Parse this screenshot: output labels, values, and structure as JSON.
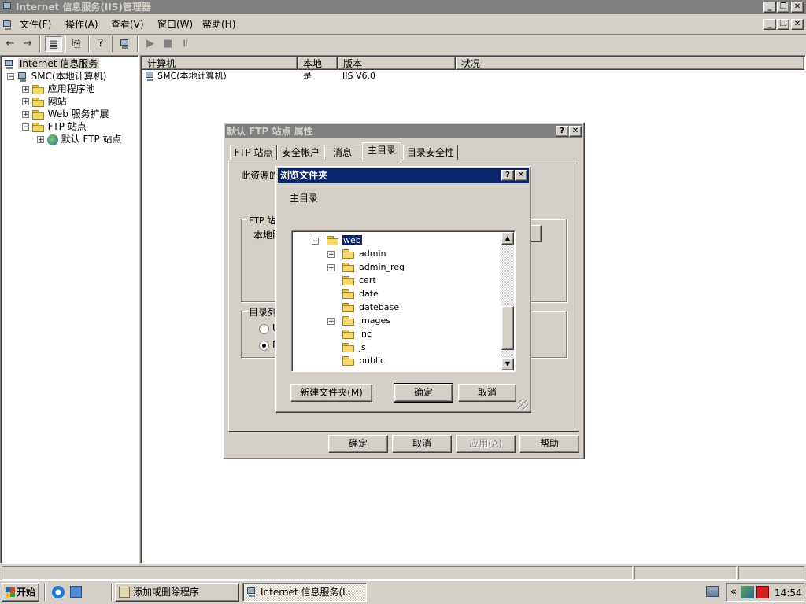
{
  "window": {
    "title": "Internet 信息服务(IIS)管理器"
  },
  "menu": {
    "items": [
      "文件(F)",
      "操作(A)",
      "查看(V)",
      "窗口(W)",
      "帮助(H)"
    ]
  },
  "tree": {
    "root": "Internet 信息服务",
    "computer": "SMC(本地计算机)",
    "app_pools": "应用程序池",
    "websites": "网站",
    "web_ext": "Web 服务扩展",
    "ftp_sites": "FTP 站点",
    "default_ftp": "默认 FTP 站点"
  },
  "list": {
    "headers": [
      "计算机",
      "本地",
      "版本",
      "状况"
    ],
    "rows": [
      {
        "computer": "SMC(本地计算机)",
        "local": "是",
        "version": "IIS V6.0",
        "status": ""
      }
    ]
  },
  "properties_dialog": {
    "title": "默认 FTP 站点 属性",
    "tabs": [
      "FTP 站点",
      "安全帐户",
      "消息",
      "主目录",
      "目录安全性"
    ],
    "active_tab": "主目录",
    "content_label": "此资源的",
    "group1_label": "FTP 站",
    "local_path_label": "本地路",
    "group2_label": "目录列",
    "radio1": "U",
    "radio2": "M",
    "ok": "确定",
    "cancel": "取消",
    "apply": "应用(A)",
    "help": "帮助"
  },
  "browse_dialog": {
    "title": "浏览文件夹",
    "prompt": "主目录",
    "folders": [
      {
        "name": "web",
        "expandable": false,
        "expanded": true,
        "selected": true,
        "level": 0
      },
      {
        "name": "admin",
        "expandable": true,
        "level": 1
      },
      {
        "name": "admin_reg",
        "expandable": true,
        "level": 1
      },
      {
        "name": "cert",
        "expandable": false,
        "level": 1
      },
      {
        "name": "date",
        "expandable": false,
        "level": 1
      },
      {
        "name": "datebase",
        "expandable": false,
        "level": 1
      },
      {
        "name": "images",
        "expandable": true,
        "level": 1
      },
      {
        "name": "inc",
        "expandable": false,
        "level": 1
      },
      {
        "name": "js",
        "expandable": false,
        "level": 1
      },
      {
        "name": "public",
        "expandable": false,
        "level": 1
      }
    ],
    "new_folder": "新建文件夹(M)",
    "ok": "确定",
    "cancel": "取消"
  },
  "taskbar": {
    "start": "开始",
    "tasks": [
      "添加或删除程序",
      "Internet 信息服务(I..."
    ],
    "clock": "14:54",
    "tray_chevron": "«"
  }
}
